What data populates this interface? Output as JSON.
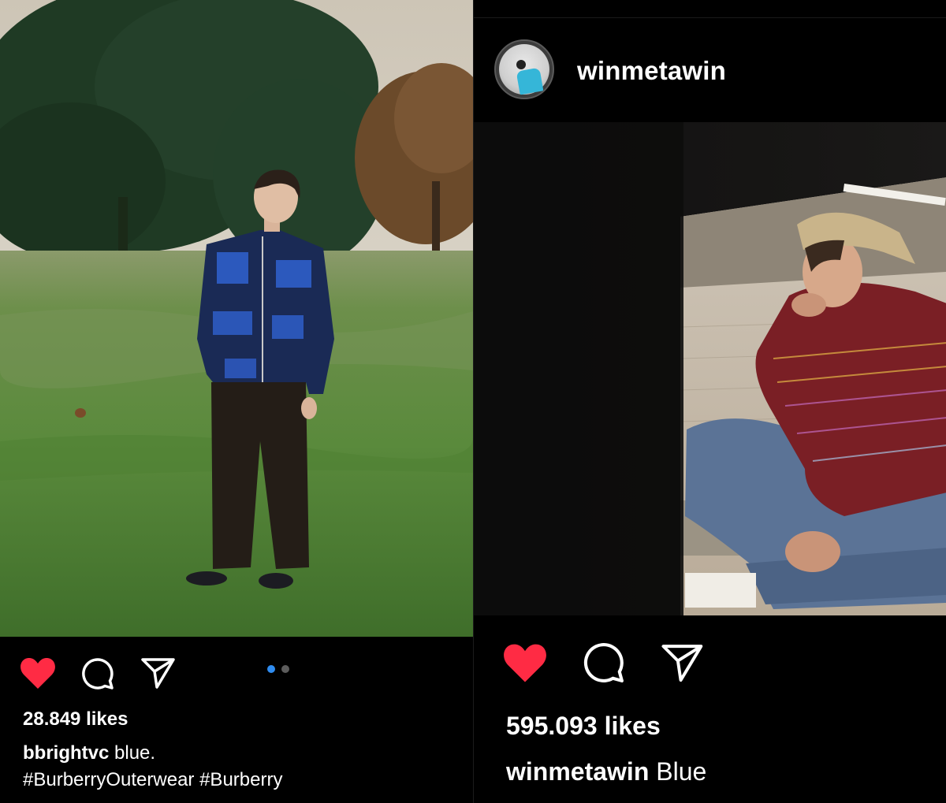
{
  "left_post": {
    "likes": "28.849 likes",
    "username": "bbrightvc",
    "caption": "blue.",
    "hashtags": "#BurberryOuterwear #Burberry",
    "carousel": {
      "count": 2,
      "active_index": 0
    },
    "colors": {
      "like_red": "#ff2b44",
      "dot_active": "#2f8cf0",
      "dot_inactive": "#5c5c5c"
    },
    "icons": [
      "heart-icon",
      "comment-icon",
      "share-icon"
    ]
  },
  "right_post": {
    "header_username": "winmetawin",
    "likes": "595.093 likes",
    "username": "winmetawin",
    "caption": "Blue",
    "colors": {
      "like_red": "#ff2b44"
    },
    "icons": [
      "heart-icon",
      "comment-icon",
      "share-icon"
    ]
  }
}
